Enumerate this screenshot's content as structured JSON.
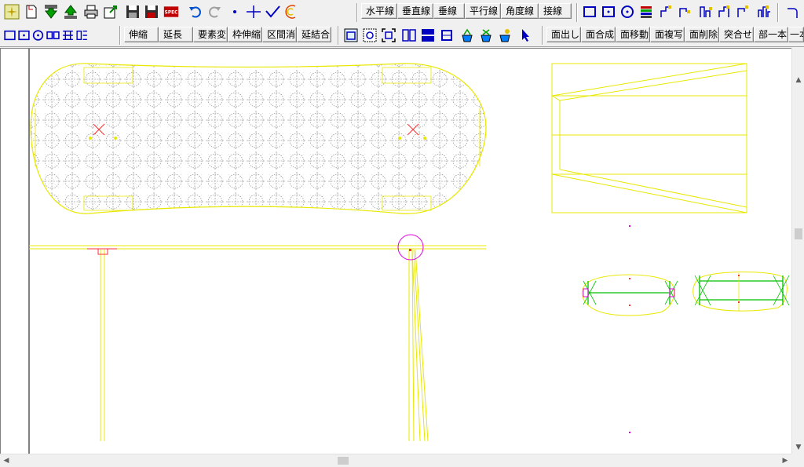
{
  "toolbar_top": {
    "text_buttons": [
      "水平線",
      "垂直線",
      "垂線",
      "平行線",
      "角度線",
      "接線"
    ],
    "icons": [
      "new-sparkle-icon",
      "new-document-icon",
      "open-green-arrow-icon",
      "save-green-arrow-icon",
      "print-icon",
      "export-icon",
      "save-disk-icon",
      "save-as-disk-icon",
      "spec-icon",
      "undo-icon",
      "redo-icon",
      "point-icon",
      "cross-line-icon",
      "check-line-icon",
      "arc-icon"
    ],
    "shape_icons": [
      "rectangle-icon",
      "rectangle-dot-icon",
      "circle-icon",
      "layers-icon",
      "shape-a-icon",
      "shape-b-icon",
      "shape-c-icon",
      "shape-d-icon",
      "shape-e-icon",
      "shape-f-icon",
      "corner-icon"
    ],
    "spec_label": "SPEC"
  },
  "toolbar_second": {
    "edit_buttons": [
      "伸縮",
      "延長",
      "要素変",
      "枠伸縮",
      "区間消",
      "延結合"
    ],
    "face_buttons": [
      "面出し",
      "面合成",
      "面移動",
      "面複写",
      "面削除",
      "突合せ",
      "部一本",
      "一本"
    ],
    "view_icons": [
      "window-icon",
      "zoom-all-icon",
      "zoom-fit-icon",
      "split-vertical-icon",
      "split-horizontal-icon",
      "box-icon",
      "paint-a-icon",
      "paint-b-icon",
      "paint-c-icon",
      "pointer-icon"
    ],
    "small_icons": [
      "square-icon",
      "square-dot-icon",
      "circle-small-icon",
      "double-square-icon",
      "grid-icon",
      "grid-b-icon"
    ]
  },
  "colors": {
    "outline": "#e8e800",
    "pattern": "#7a7a7a",
    "marker": "#ff3030",
    "highlight": "#e000e0",
    "accent_green": "#00c000",
    "accent_blue": "#0000c0"
  }
}
